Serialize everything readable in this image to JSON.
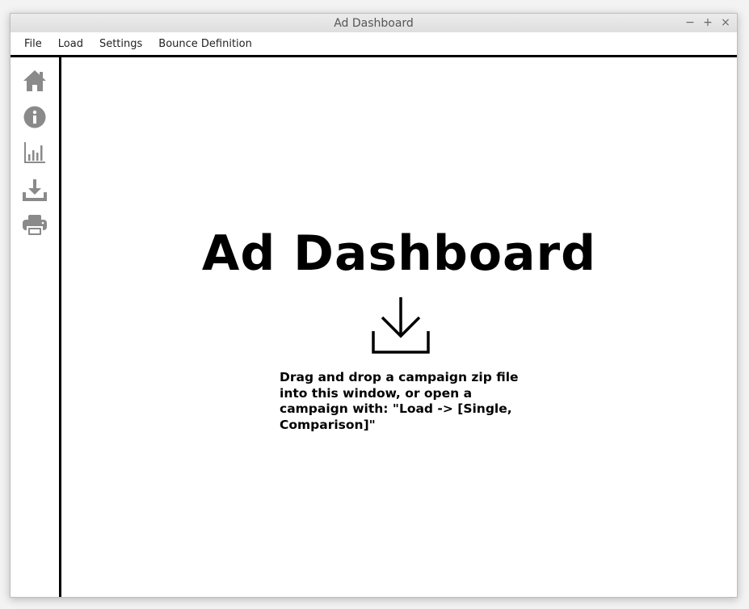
{
  "window": {
    "title": "Ad Dashboard",
    "controls": {
      "minimize": "−",
      "maximize": "+",
      "close": "×"
    }
  },
  "menubar": {
    "items": [
      {
        "label": "File"
      },
      {
        "label": "Load"
      },
      {
        "label": "Settings"
      },
      {
        "label": "Bounce Definition"
      }
    ]
  },
  "sidebar": {
    "icons": [
      "home-icon",
      "info-icon",
      "bar-chart-icon",
      "download-icon",
      "print-icon"
    ],
    "icon_color": "#8a8a8a"
  },
  "main": {
    "heading": "Ad Dashboard",
    "drop_icon": "download-tray-icon",
    "instructions": "Drag and drop a campaign zip file into this window, or open a campaign with: \"Load -> [Single, Comparison]\""
  }
}
